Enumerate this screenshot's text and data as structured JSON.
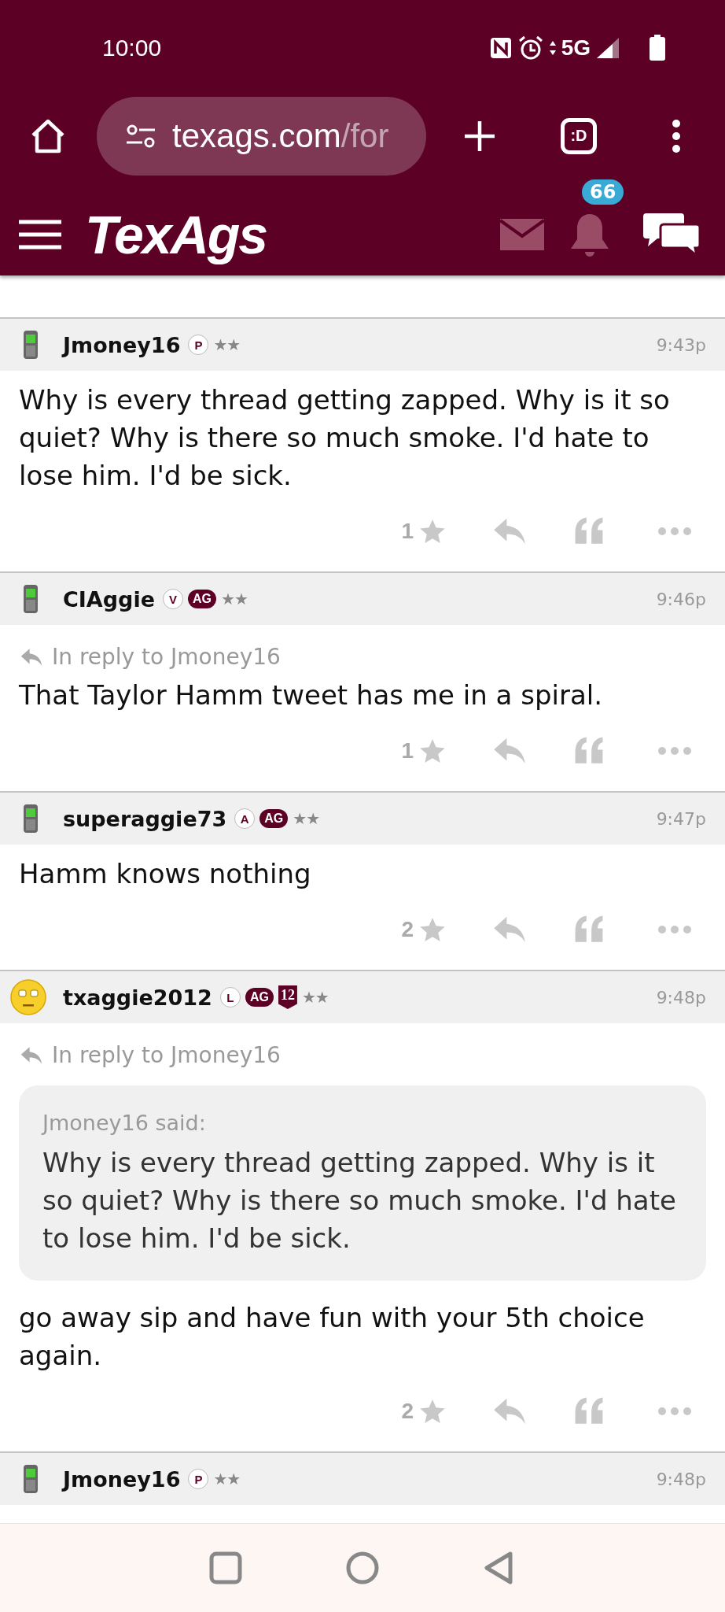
{
  "status_bar": {
    "time": "10:00",
    "network": "5G"
  },
  "browser": {
    "url_host": "texags.com",
    "url_path": "/for",
    "tab_switcher": ":D"
  },
  "site_header": {
    "logo": "TexAgs",
    "notification_count": "66"
  },
  "posts": [
    {
      "author": "Jmoney16",
      "avatar": {
        "kind": "phone"
      },
      "badges": [
        {
          "kind": "letter",
          "text": "P"
        }
      ],
      "rank": "★★",
      "time": "9:43p",
      "body": "Why is every thread getting zapped. Why is it so quiet? Why is there so much smoke. I'd hate to lose him. I'd be sick.",
      "star_count": "1"
    },
    {
      "author": "CIAggie",
      "avatar": {
        "kind": "phone"
      },
      "badges": [
        {
          "kind": "letter",
          "text": "V"
        },
        {
          "kind": "ag",
          "text": "AG"
        }
      ],
      "rank": "★★",
      "time": "9:46p",
      "reply_to": "In reply to Jmoney16",
      "body": "That Taylor Hamm tweet has me in a spiral.",
      "star_count": "1"
    },
    {
      "author": "superaggie73",
      "avatar": {
        "kind": "phone"
      },
      "badges": [
        {
          "kind": "letter",
          "text": "A"
        },
        {
          "kind": "ag",
          "text": "AG"
        }
      ],
      "rank": "★★",
      "time": "9:47p",
      "body": "Hamm knows nothing",
      "star_count": "2"
    },
    {
      "author": "txaggie2012",
      "avatar": {
        "kind": "emoji"
      },
      "badges": [
        {
          "kind": "letter",
          "text": "L"
        },
        {
          "kind": "ag",
          "text": "AG"
        },
        {
          "kind": "year",
          "text": "12"
        }
      ],
      "rank": "★★",
      "time": "9:48p",
      "reply_to": "In reply to Jmoney16",
      "quote": {
        "attribution": "Jmoney16 said:",
        "text": "Why is every thread getting zapped. Why is it so quiet? Why is there so much smoke. I'd hate to lose him. I'd be sick."
      },
      "body": "go away sip and have fun with your 5th choice again.",
      "star_count": "2"
    },
    {
      "author": "Jmoney16",
      "avatar": {
        "kind": "phone"
      },
      "badges": [
        {
          "kind": "letter",
          "text": "P"
        }
      ],
      "rank": "★★",
      "time": "9:48p"
    }
  ]
}
